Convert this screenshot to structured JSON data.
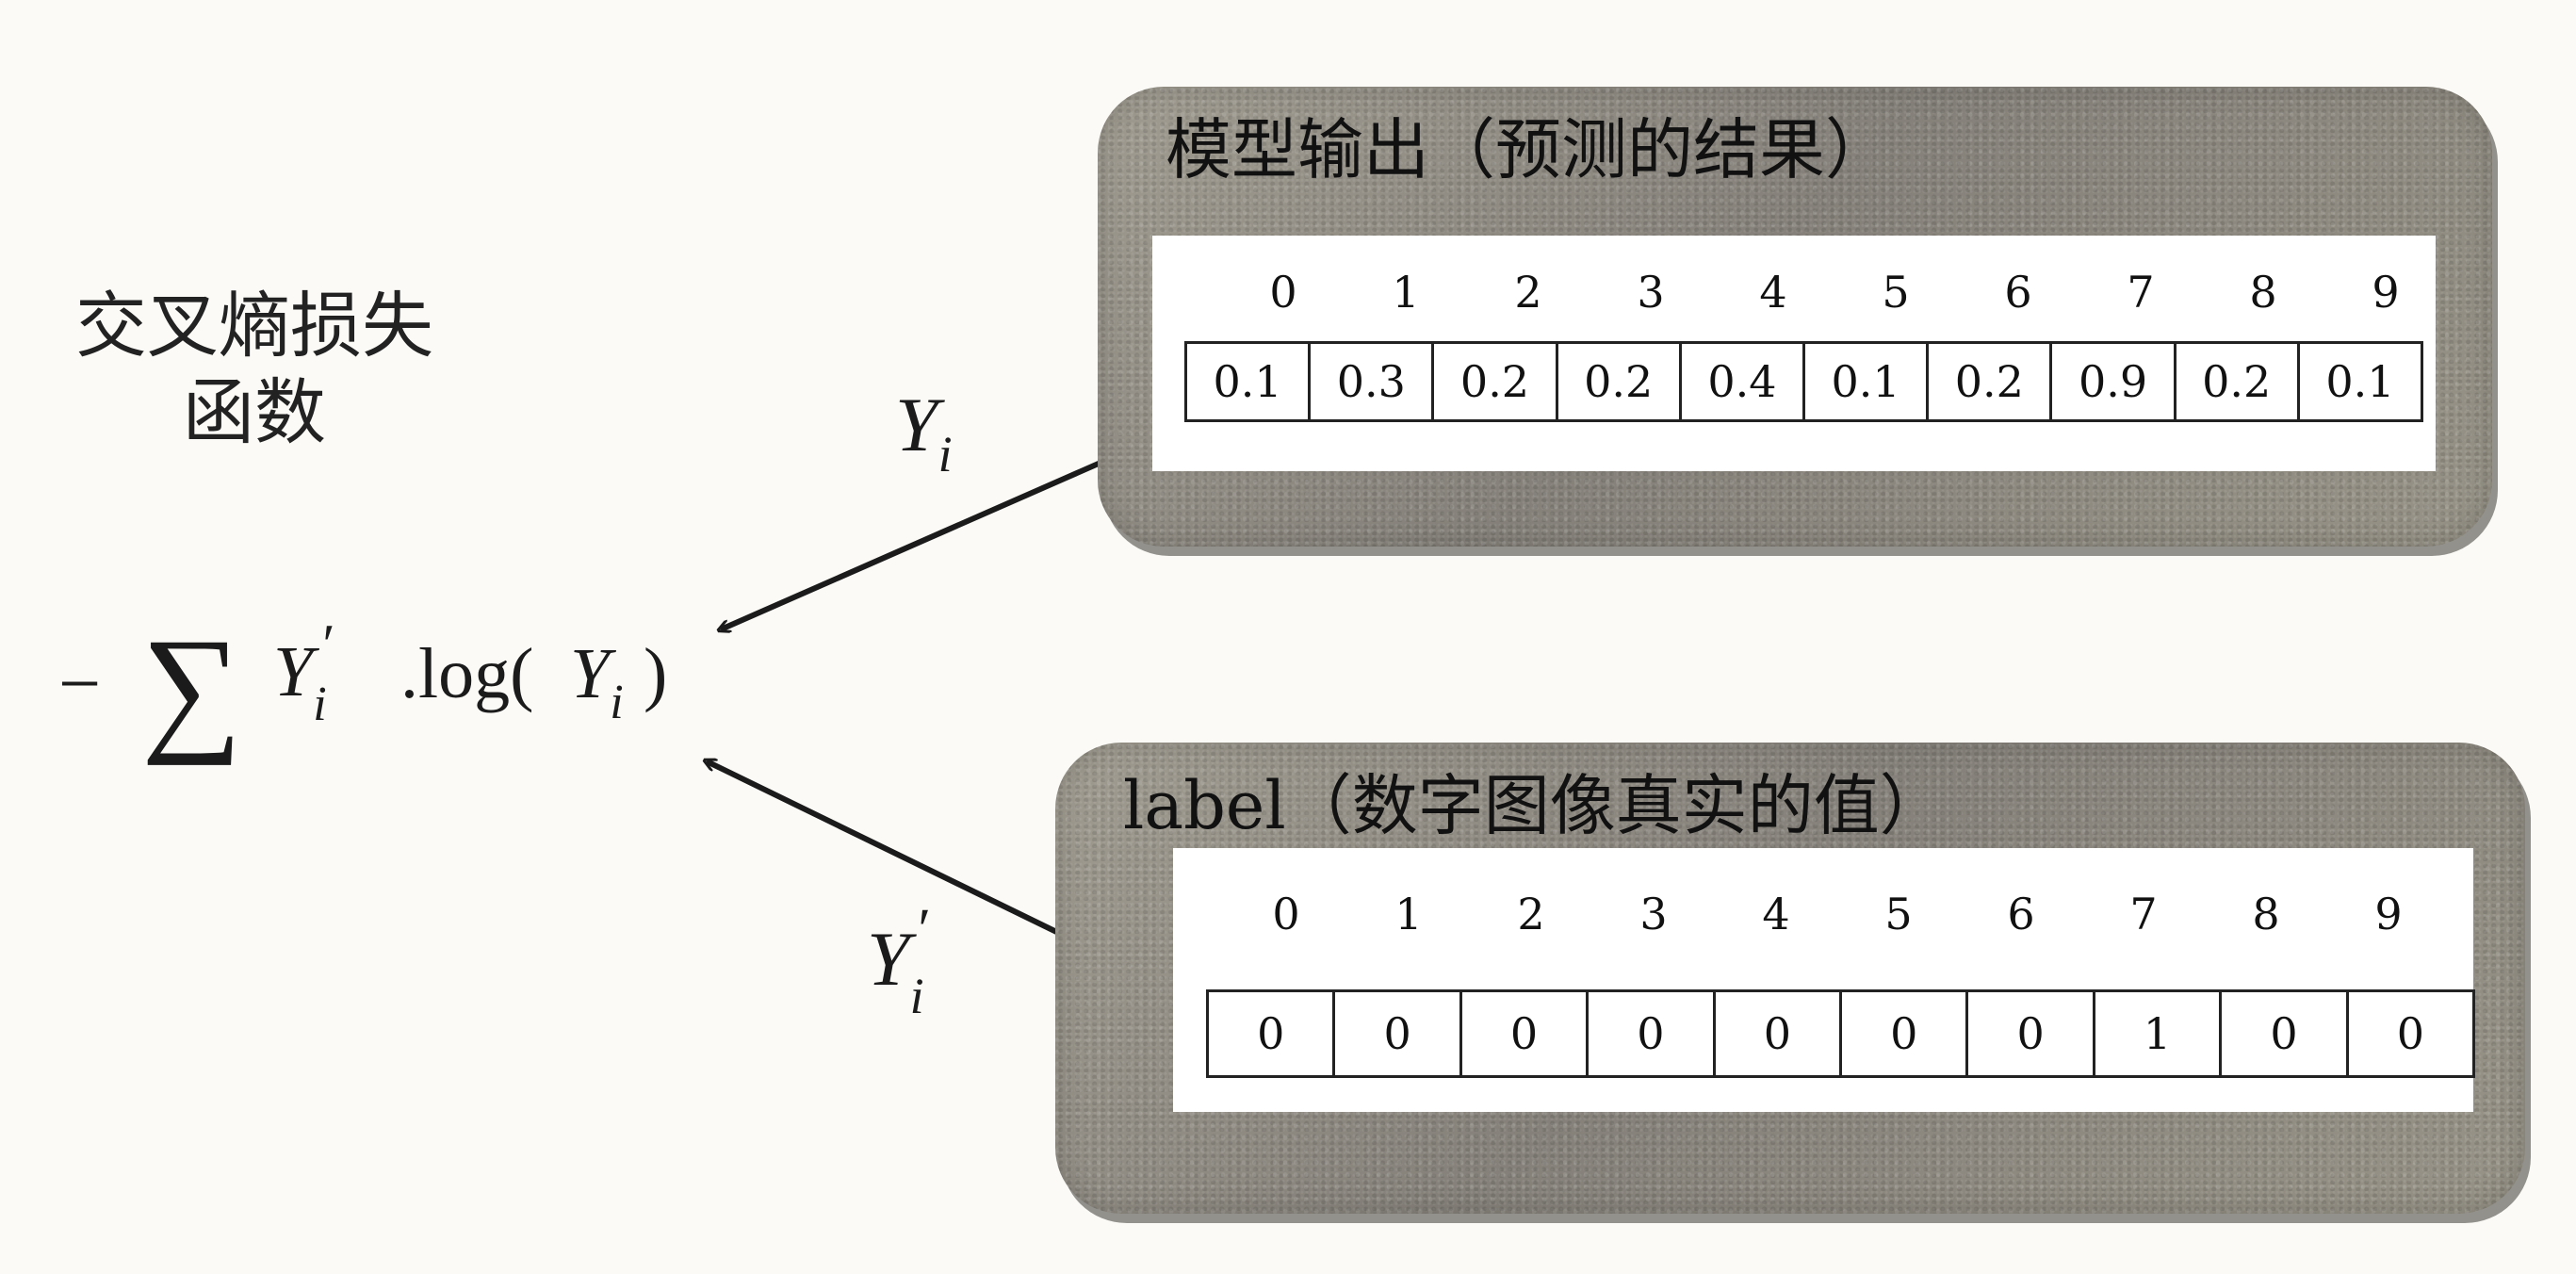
{
  "caption": {
    "line1": "交叉熵损失",
    "line2": "函数"
  },
  "formula": {
    "minus": "−",
    "sum": "∑",
    "y_prime_base": "Y",
    "y_prime_sub": "i",
    "y_prime_mark": "′",
    "dot_log": ".log(",
    "y_base": "Y",
    "y_sub": "i",
    "close": ")"
  },
  "arrow_labels": {
    "yi_base": "Y",
    "yi_sub": "i",
    "yi_prime_base": "Y",
    "yi_prime_sub": "i",
    "yi_prime_mark": "′"
  },
  "model_output": {
    "title": "模型输出（预测的结果）",
    "indices": [
      "0",
      "1",
      "2",
      "3",
      "4",
      "5",
      "6",
      "7",
      "8",
      "9"
    ],
    "values": [
      "0.1",
      "0.3",
      "0.2",
      "0.2",
      "0.4",
      "0.1",
      "0.2",
      "0.9",
      "0.2",
      "0.1"
    ]
  },
  "label": {
    "title": "label（数字图像真实的值）",
    "indices": [
      "0",
      "1",
      "2",
      "3",
      "4",
      "5",
      "6",
      "7",
      "8",
      "9"
    ],
    "values": [
      "0",
      "0",
      "0",
      "0",
      "0",
      "0",
      "0",
      "1",
      "0",
      "0"
    ]
  },
  "colors": {
    "panel": "#8f8b80",
    "inner": "#ffffff",
    "ink": "#1b1b1b"
  }
}
